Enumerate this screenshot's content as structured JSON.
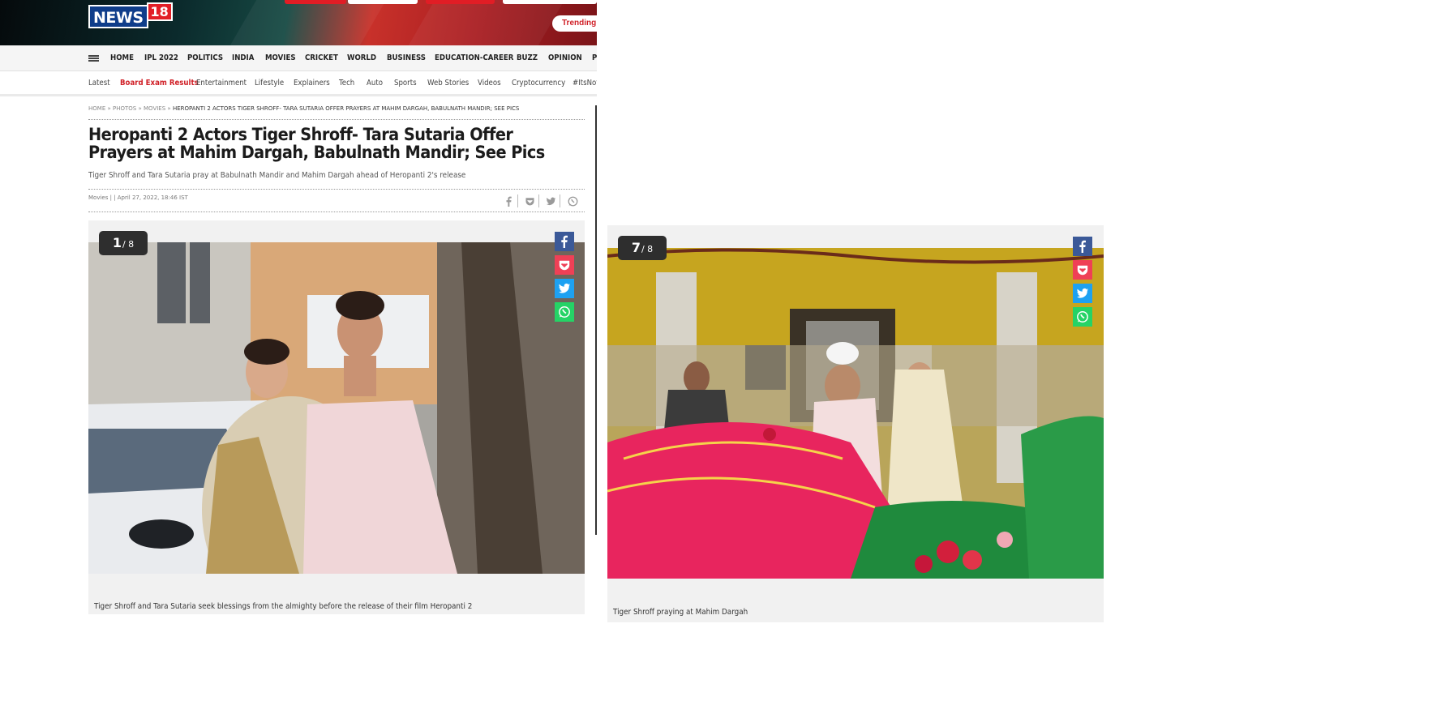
{
  "logo": {
    "part1": "NEWS",
    "part2": "18"
  },
  "trending_label": "Trending To",
  "nav_primary": [
    "HOME",
    "IPL 2022",
    "POLITICS",
    "INDIA",
    "MOVIES",
    "CRICKET",
    "WORLD",
    "BUSINESS",
    "EDUCATION-CAREER",
    "BUZZ",
    "OPINION",
    "P"
  ],
  "nav_secondary": [
    "Latest",
    "Board Exam Results",
    "Entertainment",
    "Lifestyle",
    "Explainers",
    "Tech",
    "Auto",
    "Sports",
    "Web Stories",
    "Videos",
    "Cryptocurrency",
    "#ItsNot"
  ],
  "breadcrumb": {
    "home": "HOME",
    "sep": "»",
    "photos": "PHOTOS",
    "movies": "MOVIES",
    "current": "HEROPANTI 2 ACTORS TIGER SHROFF- TARA SUTARIA OFFER PRAYERS AT MAHIM DARGAH, BABULNATH MANDIR; SEE PICS"
  },
  "article": {
    "headline": "Heropanti 2 Actors Tiger Shroff- Tara Sutaria Offer Prayers at Mahim Dargah, Babulnath Mandir; See Pics",
    "summary": "Tiger Shroff and Tara Sutaria pray at Babulnath Mandir and Mahim Dargah ahead of Heropanti 2's release",
    "meta": "Movies | | April 27, 2022, 18:46 IST"
  },
  "share_icons": [
    "facebook-icon",
    "pocket-icon",
    "twitter-icon",
    "whatsapp-icon"
  ],
  "gallery1": {
    "index": "1",
    "total": "/ 8",
    "caption": "Tiger Shroff and Tara Sutaria seek blessings from the almighty before the release of their film Heropanti 2"
  },
  "gallery2": {
    "index": "7",
    "total": "/ 8",
    "caption": "Tiger Shroff praying at Mahim Dargah"
  },
  "colors": {
    "facebook": "#3b5998",
    "pocket": "#ef4056",
    "twitter": "#1da1f2",
    "whatsapp": "#25d366",
    "brand_red": "#d01f26"
  }
}
